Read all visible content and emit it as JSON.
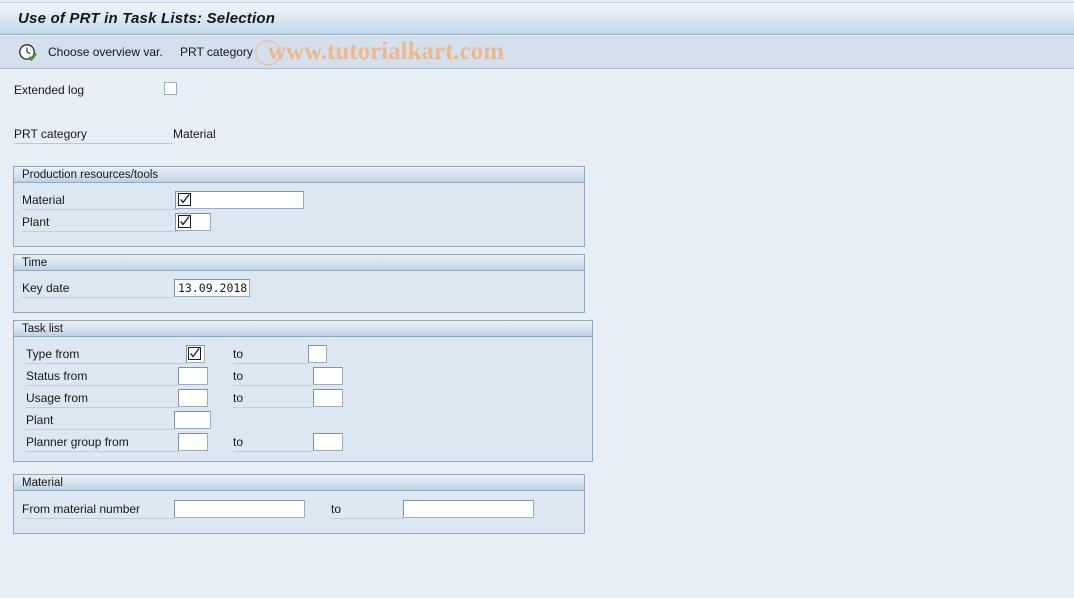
{
  "window": {
    "title": "Use of PRT in Task Lists: Selection"
  },
  "toolbar": {
    "execute_icon": "clock-check-icon",
    "choose_overview_label": "Choose overview var.",
    "prt_category_label": "PRT category"
  },
  "watermark": {
    "text": "www.tutorialkart.com",
    "color": "#edb98c"
  },
  "top_fields": {
    "extended_log_label": "Extended log",
    "extended_log_checked": false,
    "prt_category_label": "PRT category",
    "prt_category_value": "Material"
  },
  "groups": [
    {
      "title": "Production resources/tools",
      "rows": [
        {
          "label": "Material",
          "from_value": "",
          "from_select_glyph": "checkbox-checked-icon",
          "has_to": false
        },
        {
          "label": "Plant",
          "from_value": "",
          "from_select_glyph": "checkbox-checked-icon",
          "has_to": false
        }
      ]
    },
    {
      "title": "Time",
      "rows": [
        {
          "label": "Key date",
          "from_value": "13.09.2018",
          "has_to": false
        }
      ]
    },
    {
      "title": "Task list",
      "rows": [
        {
          "label": "Type from",
          "from_value": "",
          "from_select_glyph": "checkbox-checked-icon",
          "has_to": true,
          "to_label": "to",
          "to_value": ""
        },
        {
          "label": "Status from",
          "from_value": "",
          "has_to": true,
          "to_label": "to",
          "to_value": ""
        },
        {
          "label": "Usage from",
          "from_value": "",
          "has_to": true,
          "to_label": "to",
          "to_value": ""
        },
        {
          "label": "Plant",
          "from_value": "",
          "has_to": false
        },
        {
          "label": "Planner group from",
          "from_value": "",
          "has_to": true,
          "to_label": "to",
          "to_value": ""
        }
      ]
    },
    {
      "title": "Material",
      "rows": [
        {
          "label": "From material number",
          "from_value": "",
          "has_to": true,
          "to_label": "to",
          "to_value": ""
        }
      ]
    }
  ]
}
